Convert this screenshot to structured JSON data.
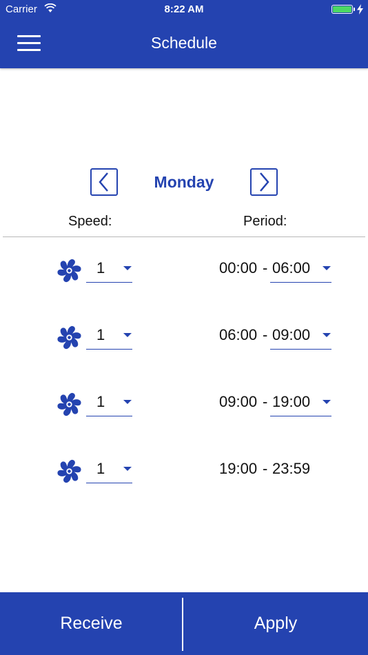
{
  "status_bar": {
    "carrier": "Carrier",
    "time": "8:22 AM",
    "wifi_icon": "wifi-icon",
    "battery_icon": "battery-charging-icon"
  },
  "nav": {
    "title": "Schedule",
    "menu_icon": "hamburger-menu-icon"
  },
  "day_selector": {
    "day": "Monday",
    "prev_icon": "chevron-left-icon",
    "next_icon": "chevron-right-icon"
  },
  "columns": {
    "speed": "Speed:",
    "period": "Period:"
  },
  "rows": [
    {
      "speed": "1",
      "start": "00:00",
      "end": "06:00",
      "end_editable": true
    },
    {
      "speed": "1",
      "start": "06:00",
      "end": "09:00",
      "end_editable": true
    },
    {
      "speed": "1",
      "start": "09:00",
      "end": "19:00",
      "end_editable": true
    },
    {
      "speed": "1",
      "start": "19:00",
      "end": "23:59",
      "end_editable": false
    }
  ],
  "period_separator": "-",
  "actions": {
    "receive": "Receive",
    "apply": "Apply"
  },
  "colors": {
    "primary": "#2443b0",
    "battery": "#4cd964",
    "text": "#111111"
  }
}
